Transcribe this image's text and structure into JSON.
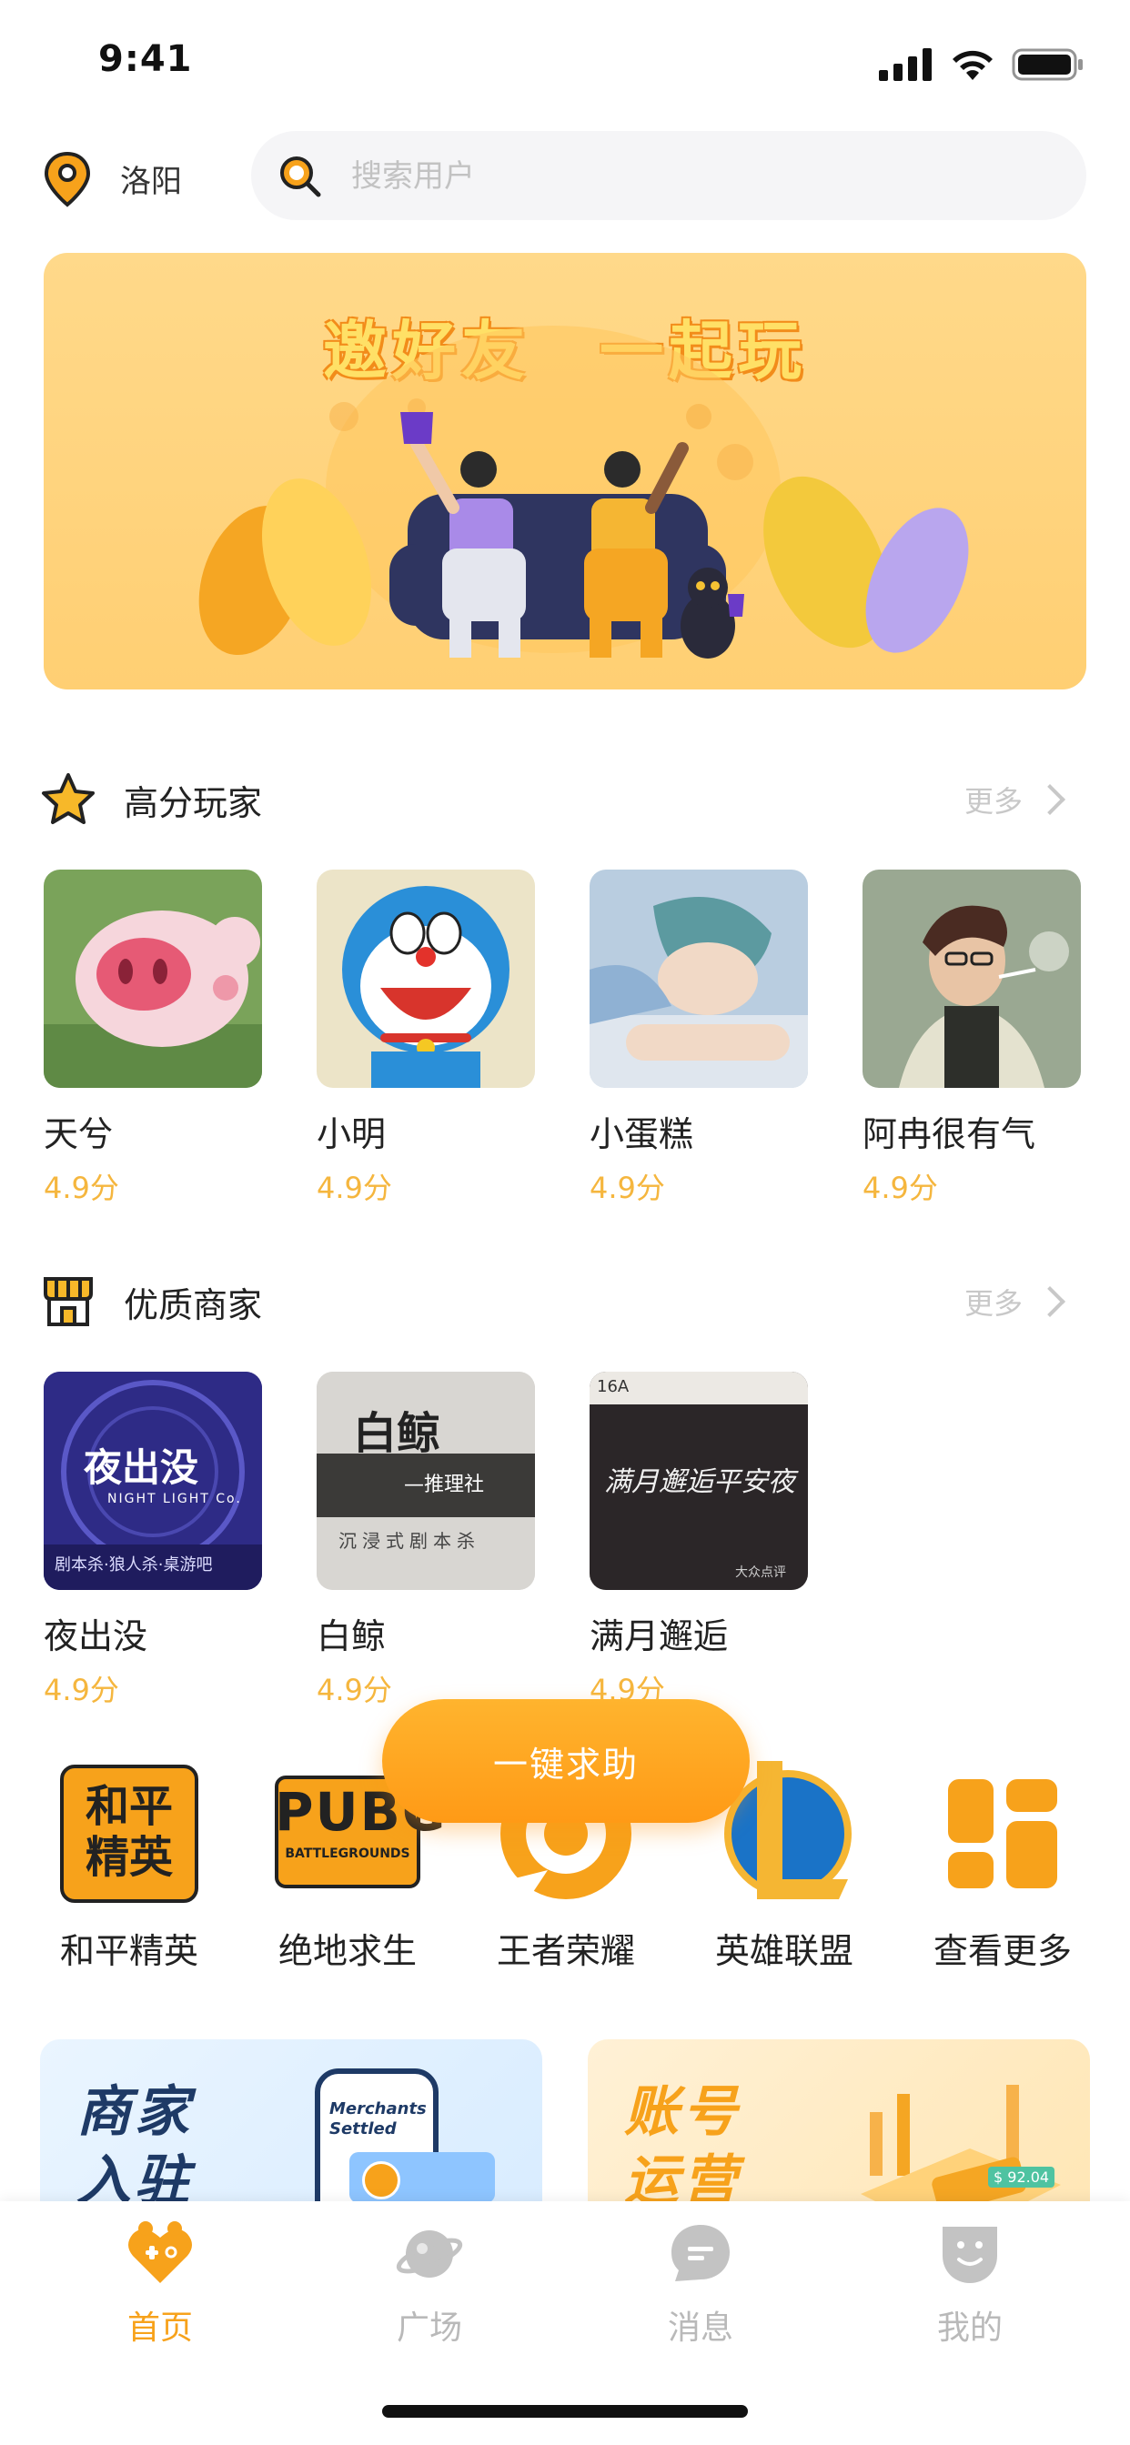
{
  "status_bar": {
    "time": "9:41"
  },
  "location": {
    "city": "洛阳"
  },
  "search": {
    "placeholder": "搜索用户"
  },
  "banner": {
    "title": "邀好友　一起玩"
  },
  "top_players": {
    "title": "高分玩家",
    "more": "更多",
    "items": [
      {
        "name": "天兮",
        "score": "4.9分"
      },
      {
        "name": "小明",
        "score": "4.9分"
      },
      {
        "name": "小蛋糕",
        "score": "4.9分"
      },
      {
        "name": "阿冉很有气",
        "score": "4.9分"
      }
    ]
  },
  "merchants": {
    "title": "优质商家",
    "more": "更多",
    "items": [
      {
        "name": "夜出没",
        "score": "4.9分",
        "sign_main": "夜出没",
        "sign_sub": "NIGHT LIGHT Co.",
        "sign_foot": "剧本杀·狼人杀·桌游吧"
      },
      {
        "name": "白鲸",
        "score": "4.9分",
        "sign_main": "白鲸",
        "sign_sub": "—推理社",
        "sign_foot": "沉浸式剧本杀"
      },
      {
        "name": "满月邂逅",
        "score": "4.9分",
        "sign_main": "满月邂逅平安夜",
        "sign_sub": "16A",
        "sign_foot": "大众点评"
      }
    ]
  },
  "help_button": {
    "label": "一键求助"
  },
  "games": [
    {
      "name": "和平精英",
      "icon_text": "和平精英"
    },
    {
      "name": "绝地求生",
      "icon_text": "PUBG",
      "icon_sub": "BATTLEGROUNDS"
    },
    {
      "name": "王者荣耀"
    },
    {
      "name": "英雄联盟"
    },
    {
      "name": "查看更多"
    }
  ],
  "promos": [
    {
      "title_line1": "商家",
      "title_line2": "入驻",
      "phone_text": "Merchants Settled"
    },
    {
      "title_line1": "账号",
      "title_line2": "运营",
      "price": "$ 92.04"
    }
  ],
  "tabs": [
    {
      "label": "首页",
      "active": true
    },
    {
      "label": "广场",
      "active": false
    },
    {
      "label": "消息",
      "active": false
    },
    {
      "label": "我的",
      "active": false
    }
  ],
  "colors": {
    "accent": "#f7a21b",
    "score": "#f5b63e",
    "inactive": "#b9b9b9"
  }
}
